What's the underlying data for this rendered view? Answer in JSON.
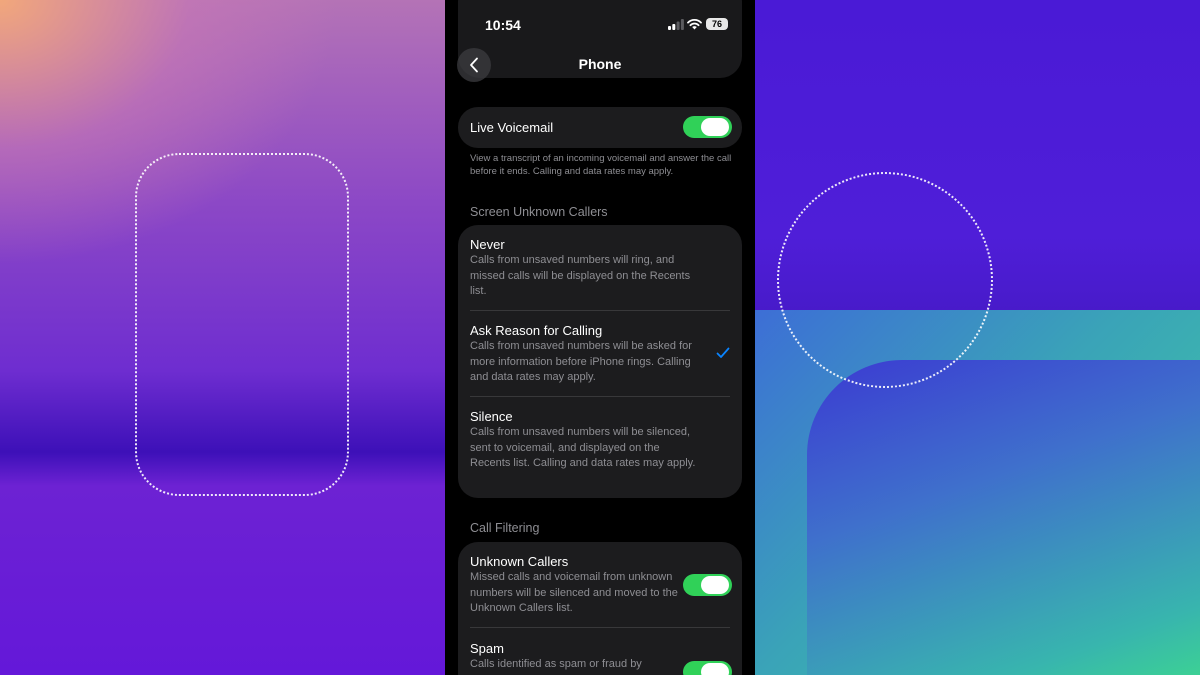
{
  "status_bar": {
    "time": "10:54",
    "battery": "76"
  },
  "nav": {
    "title": "Phone"
  },
  "live_voicemail": {
    "label": "Live Voicemail",
    "on": true,
    "footnote": "View a transcript of an incoming voicemail and answer the call before it ends. Calling and data rates may apply."
  },
  "screen_unknown": {
    "header": "Screen Unknown Callers",
    "options": [
      {
        "label": "Never",
        "desc": "Calls from unsaved numbers will ring, and missed calls will be displayed on the Recents list.",
        "selected": false
      },
      {
        "label": "Ask Reason for Calling",
        "desc": "Calls from unsaved numbers will be asked for more information before iPhone rings. Calling and data rates may apply.",
        "selected": true
      },
      {
        "label": "Silence",
        "desc": "Calls from unsaved numbers will be silenced, sent to voicemail, and displayed on the Recents list. Calling and data rates may apply.",
        "selected": false
      }
    ]
  },
  "call_filtering": {
    "header": "Call Filtering",
    "unknown_callers": {
      "label": "Unknown Callers",
      "desc": "Missed calls and voicemail from unknown numbers will be silenced and moved to the Unknown Callers list.",
      "on": true
    },
    "spam": {
      "label": "Spam",
      "desc": "Calls identified as spam or fraud by",
      "on": true
    }
  },
  "colors": {
    "accent": "#30d158",
    "check": "#0a84ff",
    "card": "#1c1c1e"
  }
}
